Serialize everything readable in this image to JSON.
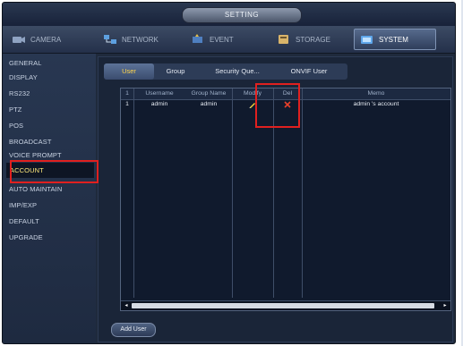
{
  "window": {
    "title": "SETTING"
  },
  "main_tabs": [
    {
      "label": "CAMERA",
      "icon": "camera-icon"
    },
    {
      "label": "NETWORK",
      "icon": "network-icon"
    },
    {
      "label": "EVENT",
      "icon": "event-icon"
    },
    {
      "label": "STORAGE",
      "icon": "storage-icon"
    },
    {
      "label": "SYSTEM",
      "icon": "system-icon",
      "active": true
    }
  ],
  "sidebar": {
    "items": [
      {
        "label": "GENERAL"
      },
      {
        "label": "DISPLAY"
      },
      {
        "label": "RS232"
      },
      {
        "label": "PTZ"
      },
      {
        "label": "POS"
      },
      {
        "label": "BROADCAST"
      },
      {
        "label": "VOICE PROMPT"
      },
      {
        "label": "ACCOUNT",
        "active": true
      },
      {
        "label": "AUTO MAINTAIN"
      },
      {
        "label": "IMP/EXP"
      },
      {
        "label": "DEFAULT"
      },
      {
        "label": "UPGRADE"
      }
    ]
  },
  "sub_tabs": [
    {
      "label": "User",
      "active": true
    },
    {
      "label": "Group"
    },
    {
      "label": "Security Que..."
    },
    {
      "label": "ONVIF User"
    }
  ],
  "table": {
    "columns": [
      "1",
      "Username",
      "Group Name",
      "Modify",
      "Del",
      "Memo"
    ],
    "rows": [
      {
        "index": "1",
        "username": "admin",
        "group": "admin",
        "modify_icon": "pencil-icon",
        "del_icon": "delete-x-icon",
        "memo": "admin 's account"
      }
    ]
  },
  "buttons": {
    "add_user": "Add User"
  },
  "colors": {
    "highlight_box": "#e0201f",
    "active_text": "#ffe97a",
    "active_subtab_text": "#ffd54a"
  }
}
